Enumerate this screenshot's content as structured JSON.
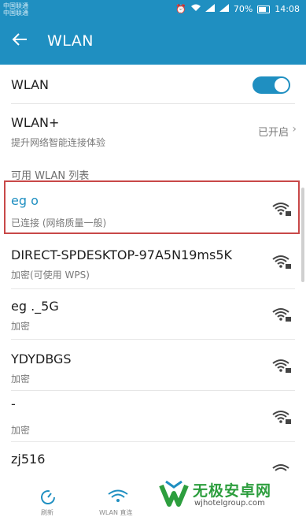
{
  "status_bar": {
    "carrier1": "中国联通",
    "carrier2": "中国联通",
    "battery": "70%",
    "time": "14:08"
  },
  "app_bar": {
    "title": "WLAN"
  },
  "wlan_toggle": {
    "label": "WLAN",
    "state": "on"
  },
  "wlan_plus": {
    "title": "WLAN+",
    "subtitle": "提升网络智能连接体验",
    "value": "已开启"
  },
  "section_header": "可用 WLAN 列表",
  "networks": [
    {
      "name": "eg  o",
      "status": "已连接 (网络质量一般)",
      "icon": "wifi-lock-icon"
    },
    {
      "name": "DIRECT-SPDESKTOP-97A5N19ms5K",
      "status": "加密(可使用 WPS)",
      "icon": "wifi-lock-icon"
    },
    {
      "name": "eg  ._5G",
      "status": "加密",
      "icon": "wifi-lock-icon"
    },
    {
      "name": "YDYDBGS",
      "status": "加密",
      "icon": "wifi-lock-icon"
    },
    {
      "name": "-",
      "status": "加密",
      "icon": "wifi-lock-icon"
    },
    {
      "name": "zj516",
      "status": "",
      "icon": "wifi-lock-icon"
    }
  ],
  "bottom_bar": {
    "refresh_label": "刷新",
    "wifi_label": "WLAN 直连"
  },
  "watermark": {
    "brand": "无极安卓网",
    "url": "wjhotelgroup.com"
  },
  "colors": {
    "accent": "#1f8fc1",
    "highlight": "#c84848",
    "brand_green": "#2d9e3e"
  }
}
